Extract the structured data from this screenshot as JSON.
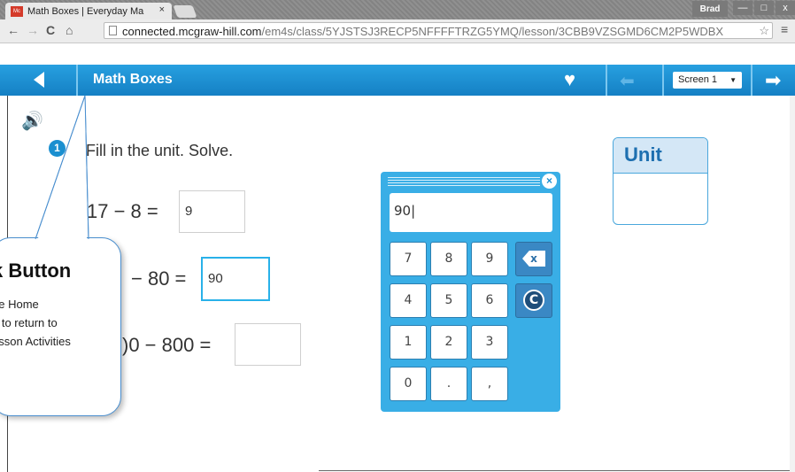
{
  "browser": {
    "tab_title": "Math Boxes | Everyday Ma",
    "tab_close": "×",
    "favicon_text": "Mc",
    "user": "Brad",
    "minimize": "—",
    "maximize": "□",
    "close": "x",
    "url_host": "connected.mcgraw-hill.com",
    "url_path": "/em4s/class/5YJSTSJ3RECP5NFFFFTRZG5YMQ/lesson/3CBB9VZSGMD6CM2P5WDBX",
    "back_icon": "←",
    "forward_icon": "→",
    "reload_icon": "C",
    "home_icon": "⌂",
    "star_icon": "☆",
    "menu_icon": "≡"
  },
  "app_header": {
    "title": "Math Boxes",
    "screen_select": "Screen 1",
    "heart_icon": "♥",
    "prev_icon": "⬅",
    "next_icon": "➡"
  },
  "lesson": {
    "problem_number": "1",
    "instruction": "Fill in the unit. Solve.",
    "equations": [
      {
        "expr": "17 − 8 =",
        "answer": "9"
      },
      {
        "expr": "− 80 =",
        "answer": "90"
      },
      {
        "expr": ")0 − 800 =",
        "answer": ""
      }
    ]
  },
  "unit_box": {
    "label": "Unit",
    "value": ""
  },
  "keypad": {
    "display": "90|",
    "close_icon": "×",
    "keys": [
      "7",
      "8",
      "9",
      "4",
      "5",
      "6",
      "1",
      "2",
      "3",
      "0",
      ".",
      ","
    ],
    "backspace_icon": "x",
    "clear_icon": "C"
  },
  "callout": {
    "title": "k Button",
    "lines": [
      "he Home",
      "n to return to",
      "esson Activities"
    ]
  },
  "colors": {
    "header_blue": "#1a8fd0",
    "keypad_blue": "#39aee6",
    "active_border": "#29b1e9",
    "unit_header": "#d4e7f6"
  }
}
